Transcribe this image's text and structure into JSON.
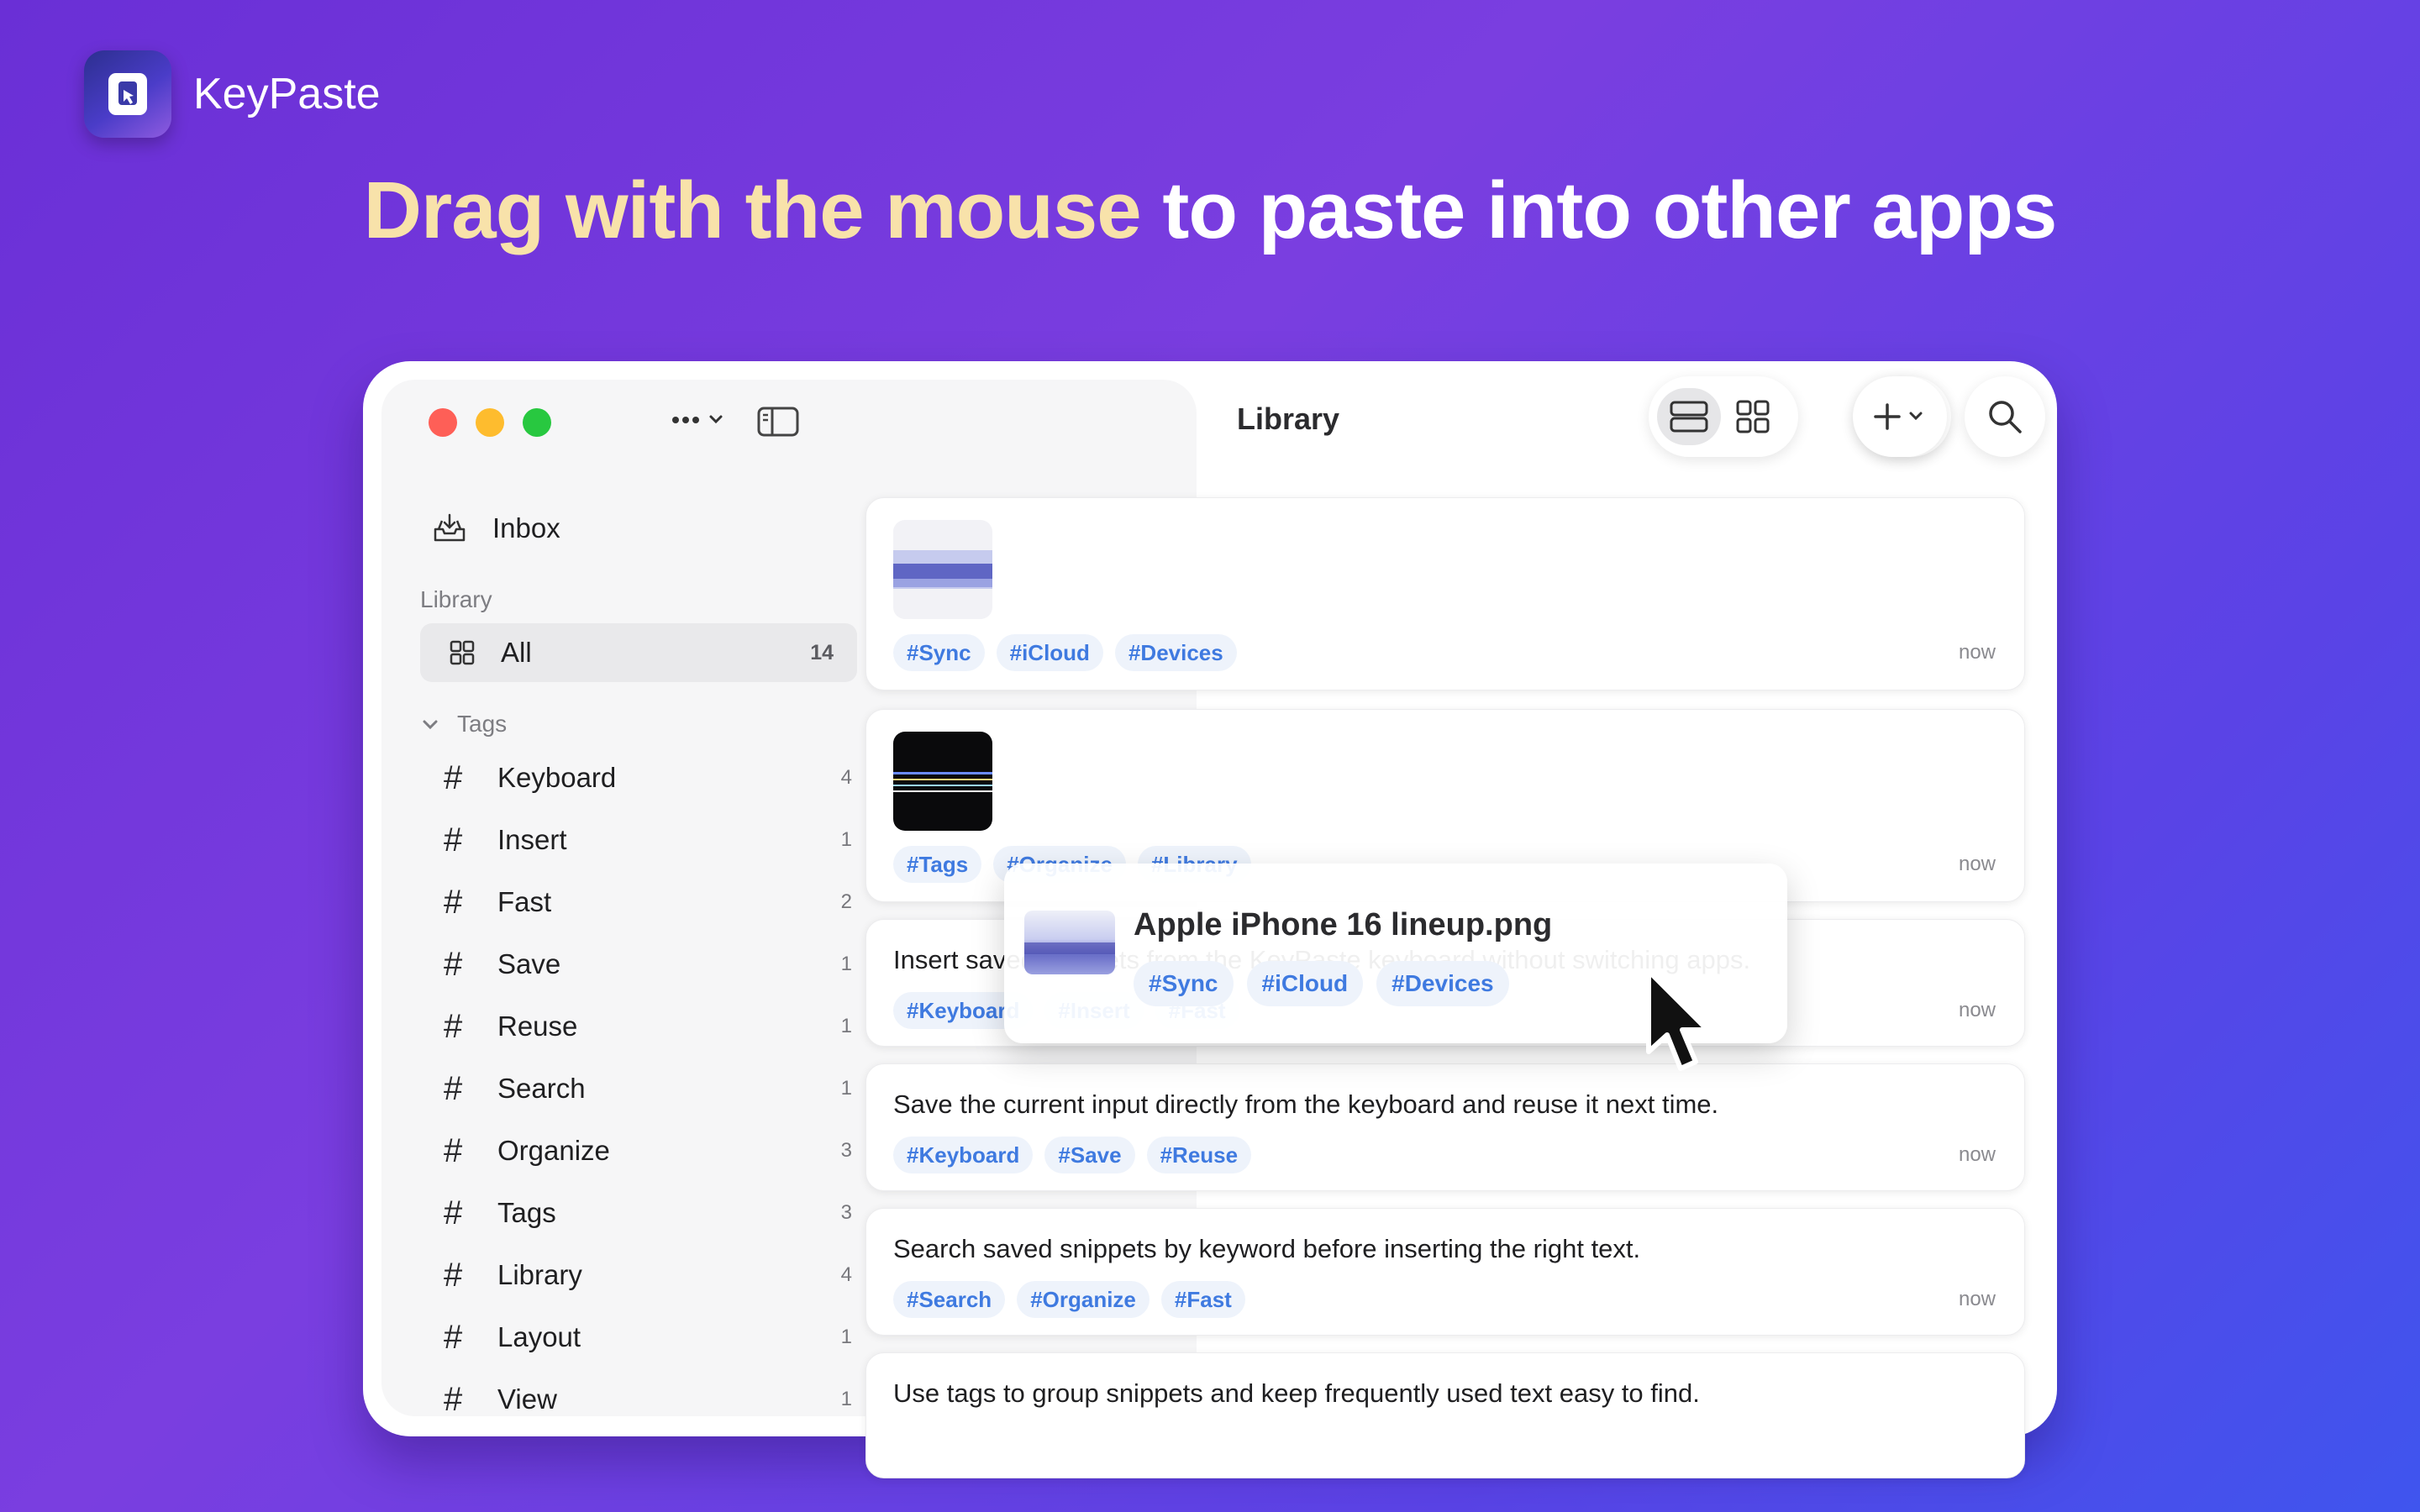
{
  "brand": {
    "name": "KeyPaste",
    "icon": "keypaste-app-icon"
  },
  "headline": {
    "highlight": "Drag with the mouse",
    "rest": " to paste into other apps"
  },
  "colors": {
    "accent": "#f8e2aa",
    "tag_text": "#3f7ae0",
    "tag_bg": "#eef3fb"
  },
  "sidebar": {
    "more_icon": "ellipsis-chevron-icon",
    "toggle_icon": "sidebar-toggle-icon",
    "inbox": {
      "label": "Inbox",
      "icon": "inbox-tray-icon"
    },
    "library_label": "Library",
    "all": {
      "label": "All",
      "count": "14",
      "icon": "grid-icon"
    },
    "tags_label": "Tags",
    "tags": [
      {
        "name": "Keyboard",
        "count": "4"
      },
      {
        "name": "Insert",
        "count": "1"
      },
      {
        "name": "Fast",
        "count": "2"
      },
      {
        "name": "Save",
        "count": "1"
      },
      {
        "name": "Reuse",
        "count": "1"
      },
      {
        "name": "Search",
        "count": "1"
      },
      {
        "name": "Organize",
        "count": "3"
      },
      {
        "name": "Tags",
        "count": "3"
      },
      {
        "name": "Library",
        "count": "4"
      },
      {
        "name": "Layout",
        "count": "1"
      },
      {
        "name": "View",
        "count": "1"
      }
    ]
  },
  "main": {
    "title": "Library",
    "toolbar": {
      "list_view_icon": "list-view-icon",
      "grid_view_icon": "grid-view-icon",
      "more_icon": "ellipsis-chevron-icon",
      "add_icon": "plus-chevron-icon",
      "search_icon": "search-icon"
    },
    "items": [
      {
        "type": "image",
        "image": "landscape-thumbnail",
        "tags": [
          "#Sync",
          "#iCloud",
          "#Devices"
        ],
        "time": "now"
      },
      {
        "type": "image",
        "image": "dark-thumbnail",
        "tags": [
          "#Tags",
          "#Organize",
          "#Library"
        ],
        "time": "now"
      },
      {
        "type": "text",
        "text": "Insert saved snippets from the KeyPaste keyboard without switching apps.",
        "tags": [
          "#Keyboard",
          "#Insert",
          "#Fast"
        ],
        "time": "now"
      },
      {
        "type": "text",
        "text": "Save the current input directly from the keyboard and reuse it next time.",
        "tags": [
          "#Keyboard",
          "#Save",
          "#Reuse"
        ],
        "time": "now"
      },
      {
        "type": "text",
        "text": "Search saved snippets by keyword before inserting the right text.",
        "tags": [
          "#Search",
          "#Organize",
          "#Fast"
        ],
        "time": "now"
      },
      {
        "type": "text",
        "text": "Use tags to group snippets and keep frequently used text easy to find.",
        "tags": [],
        "time": ""
      }
    ]
  },
  "drag_preview": {
    "title": "Apple iPhone 16 lineup.png",
    "tags": [
      "#Sync",
      "#iCloud",
      "#Devices"
    ],
    "cursor_icon": "arrow-cursor-icon"
  }
}
